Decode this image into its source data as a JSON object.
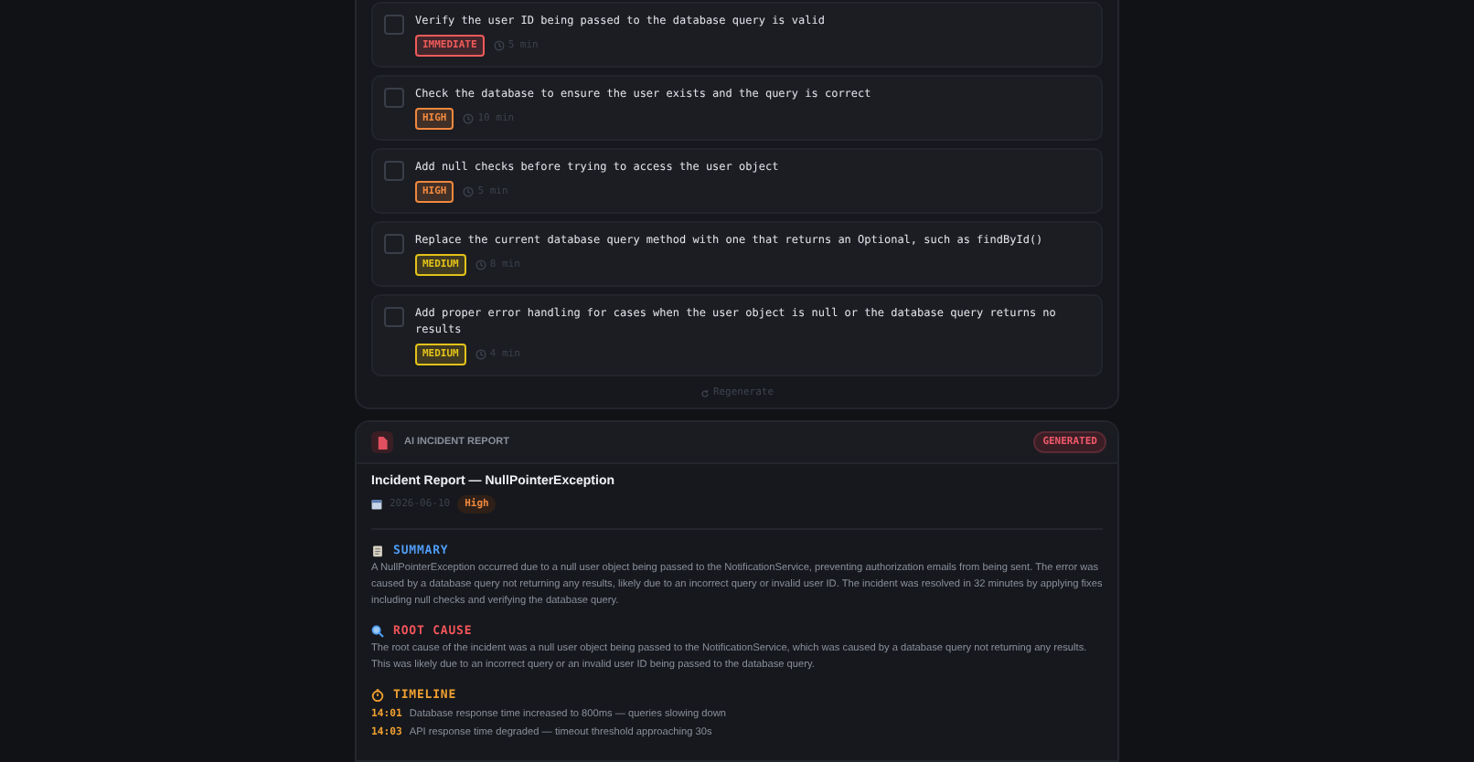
{
  "tasks": [
    {
      "text": "Verify the user ID being passed to the database query is valid",
      "checked": false,
      "priority": "IMMEDIATE",
      "color": "#f05a5a",
      "time": "5 min"
    },
    {
      "text": "Check the database to ensure the user exists and the query is correct",
      "checked": false,
      "priority": "HIGH",
      "color": "#f0883e",
      "time": "10 min"
    },
    {
      "text": "Add null checks before trying to access the user object",
      "checked": false,
      "priority": "HIGH",
      "color": "#f0883e",
      "time": "5 min"
    },
    {
      "text": "Replace the current database query method with one that returns an Optional, such as findById()",
      "checked": false,
      "priority": "MEDIUM",
      "color": "#e3c21a",
      "time": "8 min"
    },
    {
      "text": "Add proper error handling for cases when the user object is null or the database query returns no results",
      "checked": false,
      "priority": "MEDIUM",
      "color": "#e3c21a",
      "time": "4 min"
    }
  ],
  "regenerate": "Regenerate",
  "report": {
    "header": "AI INCIDENT REPORT",
    "status": "GENERATED",
    "title": "Incident Report — NullPointerException",
    "date": "2026-06-10",
    "severity": "High",
    "sections": [
      {
        "kind": "summary",
        "heading": "SUMMARY",
        "color": "#4f9cf5",
        "text": "A NullPointerException occurred due to a null user object being passed to the NotificationService, preventing authorization emails from being sent. The error was caused by a database query not returning any results, likely due to an incorrect query or invalid user ID. The incident was resolved in 32 minutes by applying fixes including null checks and verifying the database query."
      },
      {
        "kind": "root_cause",
        "heading": "ROOT CAUSE",
        "color": "#f0555a",
        "text": "The root cause of the incident was a null user object being passed to the NotificationService, which was caused by a database query not returning any results. This was likely due to an incorrect query or an invalid user ID being passed to the database query."
      },
      {
        "kind": "timeline",
        "heading": "TIMELINE",
        "color": "#f0a030",
        "entries": [
          {
            "time": "14:01",
            "text": "Database response time increased to 800ms — queries slowing down"
          },
          {
            "time": "14:03",
            "text": "API response time degraded — timeout threshold approaching 30s"
          }
        ]
      }
    ]
  }
}
